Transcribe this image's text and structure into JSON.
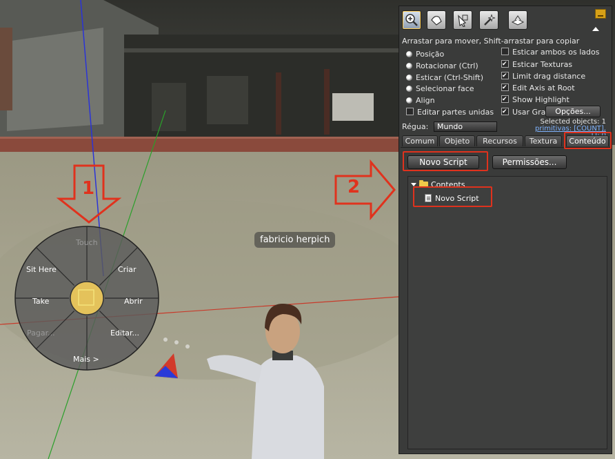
{
  "pie_menu": {
    "items": {
      "touch": "Touch",
      "criar": "Criar",
      "abrir": "Abrir",
      "editar": "Editar...",
      "mais": "Mais >",
      "pagar": "Pagar...",
      "take": "Take",
      "sit_here": "Sit Here"
    }
  },
  "avatar_nametag": "fabricio herpich",
  "annotations": {
    "step1": "1",
    "step2": "2"
  },
  "tools_panel": {
    "tool_icons": [
      "zoom-icon",
      "grab-icon",
      "edit-icon",
      "create-wand-icon",
      "land-icon"
    ],
    "hint": "Arrastar para mover, Shift-arrastar para copiar",
    "radio_options": [
      "Posição",
      "Rotacionar (Ctrl)",
      "Esticar (Ctrl-Shift)",
      "Selecionar face",
      "Align"
    ],
    "edit_linked_label": "Editar partes unidas",
    "right_options": [
      {
        "label": "Esticar ambos os lados",
        "checked": false
      },
      {
        "label": "Esticar Texturas",
        "checked": true
      },
      {
        "label": "Limit drag distance",
        "checked": true
      },
      {
        "label": "Edit Axis at Root",
        "checked": true
      },
      {
        "label": "Show Highlight",
        "checked": true
      },
      {
        "label": "Usar Gra",
        "checked": true
      }
    ],
    "opcoes_button": "Opções...",
    "selected_objects": "Selected objects: 1",
    "primitivas": "primitivas: [COUNT], LI: 0",
    "regua_label": "Régua:",
    "regua_value": "Mundo",
    "tabs": [
      "Comum",
      "Objeto",
      "Recursos",
      "Textura",
      "Conteúdo"
    ],
    "active_tab": "Conteúdo",
    "novo_script_button": "Novo Script",
    "permissoes_button": "Permissões...",
    "inventory": {
      "folder": "Contents",
      "items": [
        "Novo Script"
      ]
    }
  },
  "colors": {
    "annotation_red": "#e0321d",
    "panel_bg": "#3a3b3a",
    "link_blue": "#7fb3ff"
  }
}
